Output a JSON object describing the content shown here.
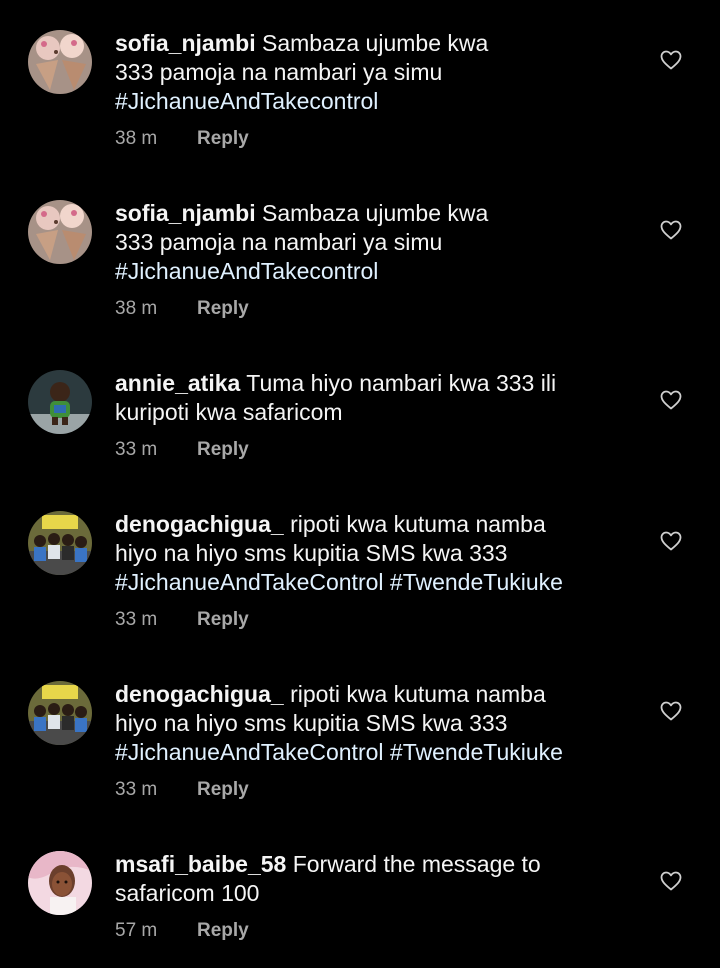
{
  "reply_label": "Reply",
  "comments": [
    {
      "username": "sofia_njambi",
      "lines": [
        "Sambaza ujumbe kwa",
        "333 pamoja na nambari ya simu"
      ],
      "hashtags": "#JichanueAndTakecontrol",
      "time": "38 m",
      "avatar": "ice-cream-cones"
    },
    {
      "username": "sofia_njambi",
      "lines": [
        "Sambaza ujumbe kwa",
        "333 pamoja na nambari ya simu"
      ],
      "hashtags": "#JichanueAndTakecontrol",
      "time": "38 m",
      "avatar": "ice-cream-cones"
    },
    {
      "username": "annie_atika",
      "lines": [
        "Tuma hiyo nambari kwa 333 ili",
        "kuripoti kwa safaricom"
      ],
      "hashtags": "",
      "time": "33 m",
      "avatar": "baby-photo"
    },
    {
      "username": "denogachigua_",
      "lines": [
        "ripoti kwa kutuma namba",
        "hiyo na hiyo sms kupitia SMS kwa 333"
      ],
      "hashtags": "#JichanueAndTakeControl #TwendeTukiuke",
      "time": "33 m",
      "avatar": "group-photo"
    },
    {
      "username": "denogachigua_",
      "lines": [
        "ripoti kwa kutuma namba",
        "hiyo na hiyo sms kupitia SMS kwa 333"
      ],
      "hashtags": "#JichanueAndTakeControl #TwendeTukiuke",
      "time": "33 m",
      "avatar": "group-photo"
    },
    {
      "username": "msafi_baibe_58",
      "lines": [
        "Forward the message to",
        "safaricom 100"
      ],
      "hashtags": "",
      "time": "57 m",
      "avatar": "portrait-photo"
    }
  ]
}
